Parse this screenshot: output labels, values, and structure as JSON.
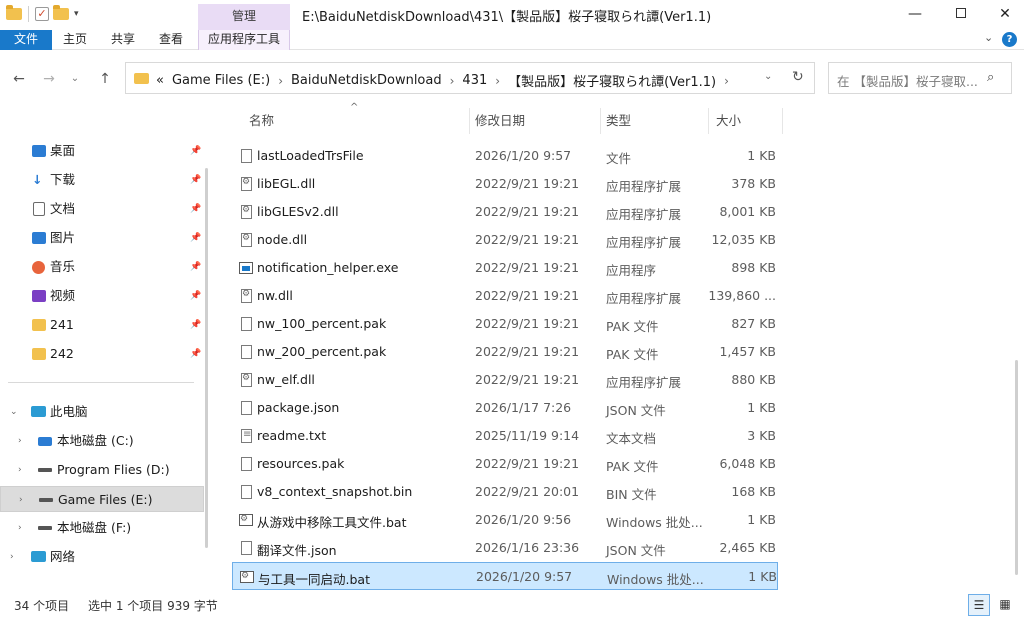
{
  "window": {
    "title": "E:\\BaiduNetdiskDownload\\431\\【製品版】桜子寝取られ譚(Ver1.1)",
    "context_tab_group": "管理",
    "minimize_glyph": "—",
    "close_glyph": "✕"
  },
  "ribbon": {
    "tabs": [
      "文件",
      "主页",
      "共享",
      "查看",
      "应用程序工具"
    ]
  },
  "nav": {
    "breadcrumbs": [
      "«",
      "Game Files (E:)",
      "BaiduNetdiskDownload",
      "431",
      "【製品版】桜子寝取られ譚(Ver1.1)"
    ],
    "search_placeholder": "在 【製品版】桜子寝取..."
  },
  "sidebar": {
    "quick_access": [
      {
        "label": "桌面",
        "icon": "desktop-icon",
        "color": "#2b7cd3"
      },
      {
        "label": "下载",
        "icon": "download-icon",
        "color": "#2b7cd3"
      },
      {
        "label": "文档",
        "icon": "document-icon",
        "color": "#6b6b6b"
      },
      {
        "label": "图片",
        "icon": "picture-icon",
        "color": "#2b7cd3"
      },
      {
        "label": "音乐",
        "icon": "music-icon",
        "color": "#e8643c"
      },
      {
        "label": "视频",
        "icon": "video-icon",
        "color": "#7b3fc4"
      },
      {
        "label": "241",
        "icon": "folder-icon",
        "color": "#f2c14e"
      },
      {
        "label": "242",
        "icon": "folder-icon",
        "color": "#f2c14e"
      }
    ],
    "this_pc": "此电脑",
    "drives": [
      {
        "label": "本地磁盘 (C:)"
      },
      {
        "label": "Program Flies (D:)"
      },
      {
        "label": "Game Files (E:)",
        "selected": true
      },
      {
        "label": "本地磁盘 (F:)"
      }
    ],
    "network": "网络"
  },
  "columns": {
    "name": "名称",
    "date": "修改日期",
    "type": "类型",
    "size": "大小"
  },
  "files": [
    {
      "name": "lastLoadedTrsFile",
      "date": "2026/1/20 9:57",
      "type": "文件",
      "size": "1 KB",
      "icon": "file-icon"
    },
    {
      "name": "libEGL.dll",
      "date": "2022/9/21 19:21",
      "type": "应用程序扩展",
      "size": "378 KB",
      "icon": "dll-icon"
    },
    {
      "name": "libGLESv2.dll",
      "date": "2022/9/21 19:21",
      "type": "应用程序扩展",
      "size": "8,001 KB",
      "icon": "dll-icon"
    },
    {
      "name": "node.dll",
      "date": "2022/9/21 19:21",
      "type": "应用程序扩展",
      "size": "12,035 KB",
      "icon": "dll-icon"
    },
    {
      "name": "notification_helper.exe",
      "date": "2022/9/21 19:21",
      "type": "应用程序",
      "size": "898 KB",
      "icon": "exe-icon"
    },
    {
      "name": "nw.dll",
      "date": "2022/9/21 19:21",
      "type": "应用程序扩展",
      "size": "139,860 ...",
      "icon": "dll-icon"
    },
    {
      "name": "nw_100_percent.pak",
      "date": "2022/9/21 19:21",
      "type": "PAK 文件",
      "size": "827 KB",
      "icon": "file-icon"
    },
    {
      "name": "nw_200_percent.pak",
      "date": "2022/9/21 19:21",
      "type": "PAK 文件",
      "size": "1,457 KB",
      "icon": "file-icon"
    },
    {
      "name": "nw_elf.dll",
      "date": "2022/9/21 19:21",
      "type": "应用程序扩展",
      "size": "880 KB",
      "icon": "dll-icon"
    },
    {
      "name": "package.json",
      "date": "2026/1/17 7:26",
      "type": "JSON 文件",
      "size": "1 KB",
      "icon": "file-icon"
    },
    {
      "name": "readme.txt",
      "date": "2025/11/19 9:14",
      "type": "文本文档",
      "size": "3 KB",
      "icon": "text-file-icon"
    },
    {
      "name": "resources.pak",
      "date": "2022/9/21 19:21",
      "type": "PAK 文件",
      "size": "6,048 KB",
      "icon": "file-icon"
    },
    {
      "name": "v8_context_snapshot.bin",
      "date": "2022/9/21 20:01",
      "type": "BIN 文件",
      "size": "168 KB",
      "icon": "file-icon"
    },
    {
      "name": "从游戏中移除工具文件.bat",
      "date": "2026/1/20 9:56",
      "type": "Windows 批处...",
      "size": "1 KB",
      "icon": "bat-icon"
    },
    {
      "name": "翻译文件.json",
      "date": "2026/1/16 23:36",
      "type": "JSON 文件",
      "size": "2,465 KB",
      "icon": "file-icon"
    },
    {
      "name": "与工具一同启动.bat",
      "date": "2026/1/20 9:57",
      "type": "Windows 批处...",
      "size": "1 KB",
      "icon": "bat-icon",
      "selected": true
    }
  ],
  "status": {
    "item_count": "34 个项目",
    "selection": "选中 1 个项目  939 字节"
  }
}
